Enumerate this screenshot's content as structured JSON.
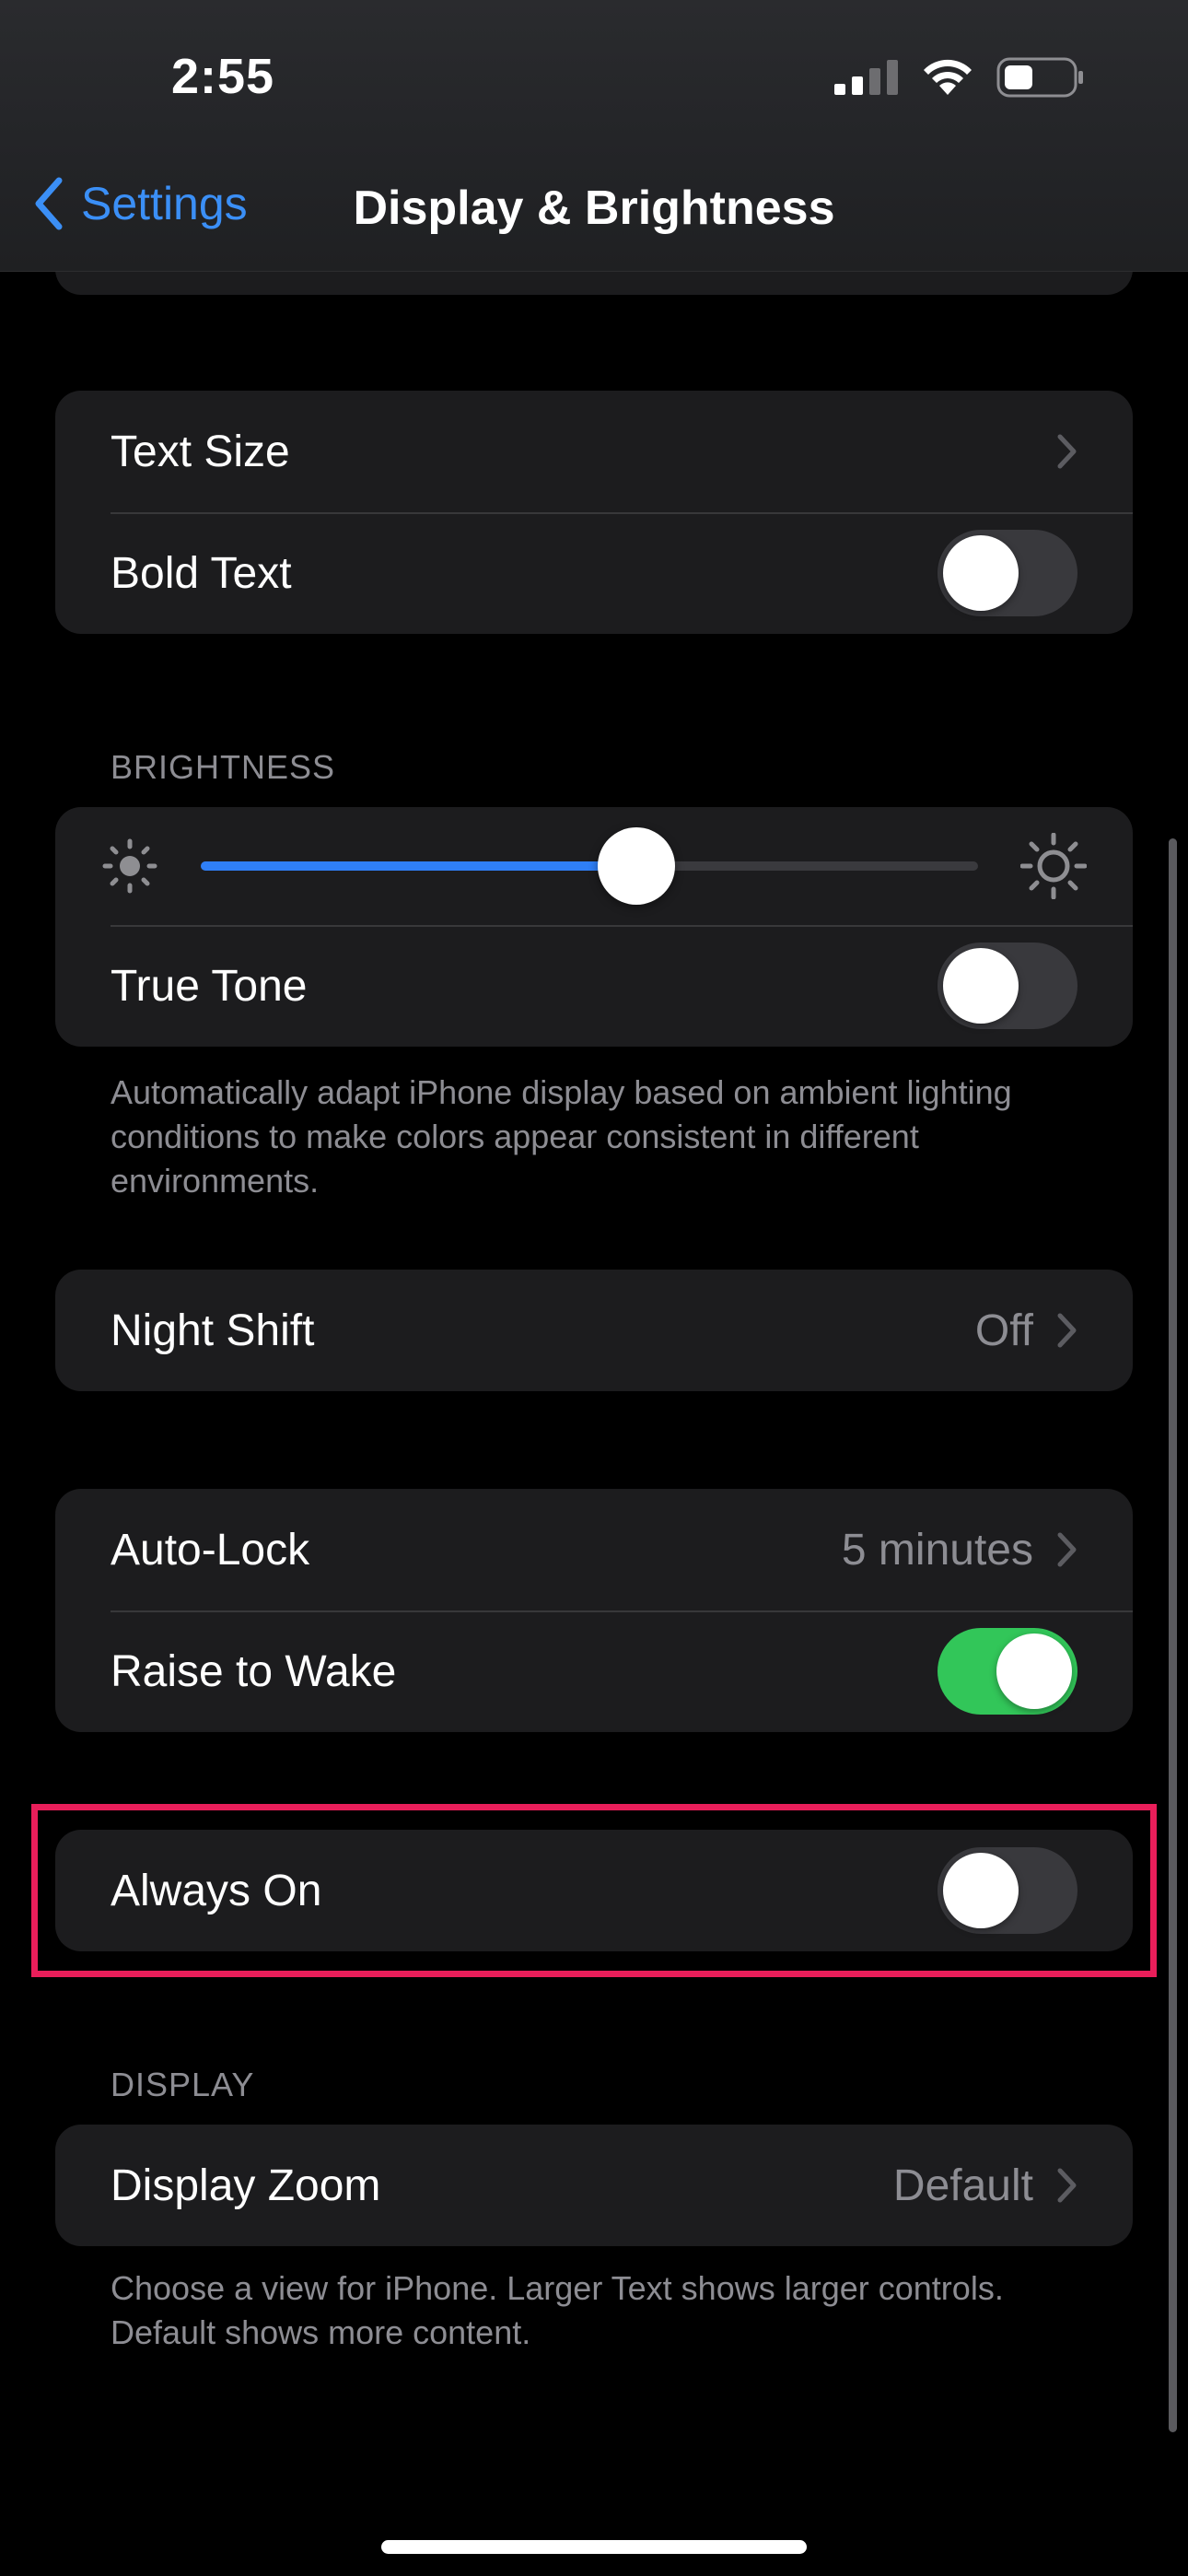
{
  "status_bar": {
    "time": "2:55",
    "icons": [
      "cellular-signal-icon",
      "wifi-icon",
      "battery-icon"
    ]
  },
  "nav": {
    "back_label": "Settings",
    "title": "Display & Brightness"
  },
  "text_group": {
    "text_size_label": "Text Size",
    "bold_text_label": "Bold Text",
    "bold_text_on": false
  },
  "brightness": {
    "header": "BRIGHTNESS",
    "level": 0.56,
    "true_tone_label": "True Tone",
    "true_tone_on": false,
    "footnote": "Automatically adapt iPhone display based on ambient lighting conditions to make colors appear consistent in different environments."
  },
  "night_shift": {
    "label": "Night Shift",
    "value": "Off"
  },
  "lock_group": {
    "auto_lock_label": "Auto-Lock",
    "auto_lock_value": "5 minutes",
    "raise_to_wake_label": "Raise to Wake",
    "raise_to_wake_on": true
  },
  "always_on": {
    "label": "Always On",
    "on": false
  },
  "display": {
    "header": "DISPLAY",
    "zoom_label": "Display Zoom",
    "zoom_value": "Default",
    "footnote": "Choose a view for iPhone. Larger Text shows larger controls. Default shows more content."
  },
  "colors": {
    "accent_blue": "#3b8ff6",
    "toggle_on_green": "#32c659",
    "highlight_border": "#e91e5a"
  }
}
